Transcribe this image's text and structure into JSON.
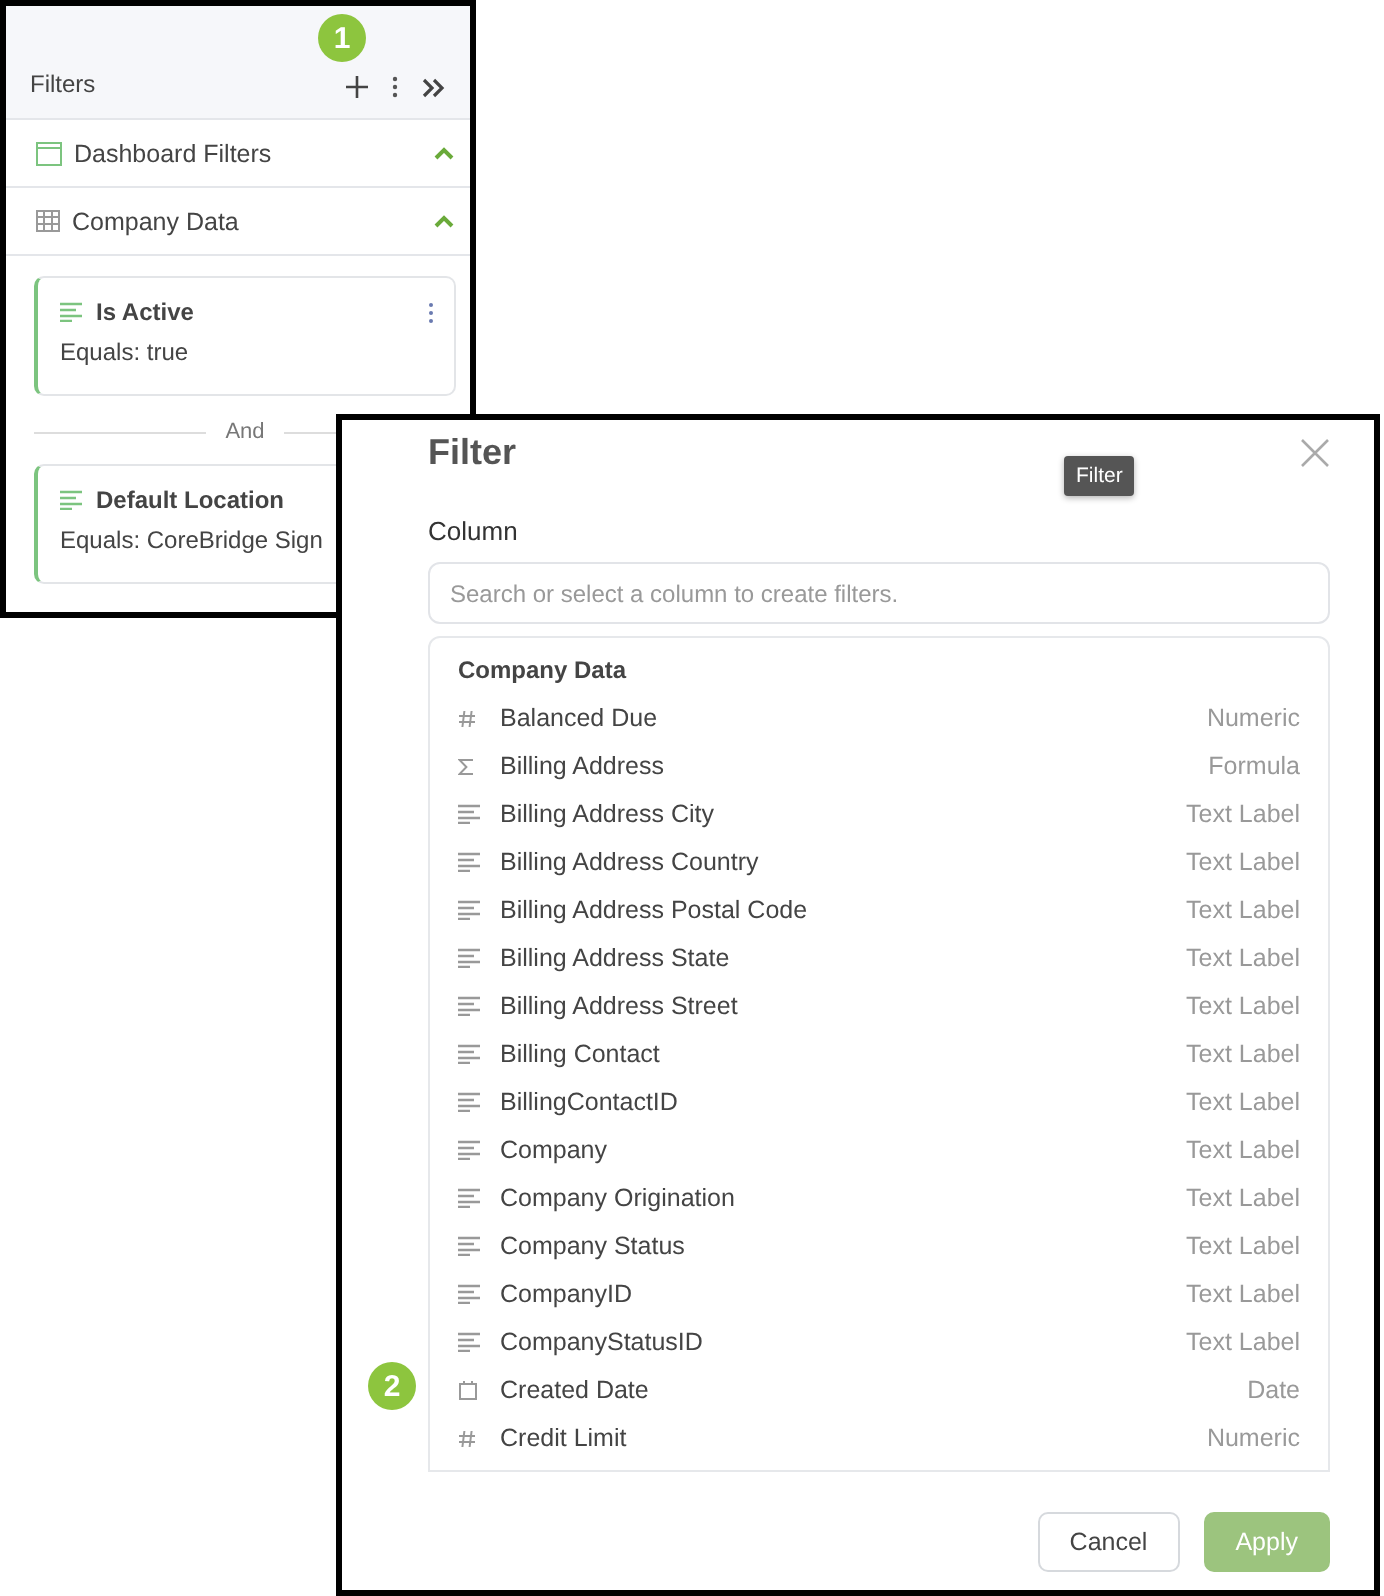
{
  "filters_panel": {
    "title": "Filters",
    "sections": [
      {
        "kind": "dashboard",
        "label": "Dashboard Filters",
        "expanded": true
      },
      {
        "kind": "table",
        "label": "Company Data",
        "expanded": true
      }
    ],
    "filters": [
      {
        "name": "Is Active",
        "condition": "Equals: true",
        "menu": true
      },
      {
        "name": "Default Location",
        "condition": "Equals: CoreBridge Sign"
      }
    ],
    "joiner": "And"
  },
  "dialog": {
    "title": "Filter",
    "tooltip": "Filter",
    "column_label": "Column",
    "search": {
      "placeholder": "Search or select a column to create filters."
    },
    "group": "Company Data",
    "columns": [
      {
        "kind": "numeric",
        "name": "Balanced Due",
        "type": "Numeric"
      },
      {
        "kind": "formula",
        "name": "Billing Address",
        "type": "Formula"
      },
      {
        "kind": "text",
        "name": "Billing Address City",
        "type": "Text Label"
      },
      {
        "kind": "text",
        "name": "Billing Address Country",
        "type": "Text Label"
      },
      {
        "kind": "text",
        "name": "Billing Address Postal Code",
        "type": "Text Label"
      },
      {
        "kind": "text",
        "name": "Billing Address State",
        "type": "Text Label"
      },
      {
        "kind": "text",
        "name": "Billing Address Street",
        "type": "Text Label"
      },
      {
        "kind": "text",
        "name": "Billing Contact",
        "type": "Text Label"
      },
      {
        "kind": "text",
        "name": "BillingContactID",
        "type": "Text Label"
      },
      {
        "kind": "text",
        "name": "Company",
        "type": "Text Label"
      },
      {
        "kind": "text",
        "name": "Company Origination",
        "type": "Text Label"
      },
      {
        "kind": "text",
        "name": "Company Status",
        "type": "Text Label"
      },
      {
        "kind": "text",
        "name": "CompanyID",
        "type": "Text Label"
      },
      {
        "kind": "text",
        "name": "CompanyStatusID",
        "type": "Text Label"
      },
      {
        "kind": "date",
        "name": "Created Date",
        "type": "Date"
      },
      {
        "kind": "numeric",
        "name": "Credit Limit",
        "type": "Numeric"
      }
    ],
    "buttons": [
      {
        "label": "Cancel",
        "disabled": false
      },
      {
        "label": "Apply",
        "disabled": true
      }
    ]
  },
  "callouts": [
    {
      "label": "1"
    },
    {
      "label": "2"
    }
  ]
}
